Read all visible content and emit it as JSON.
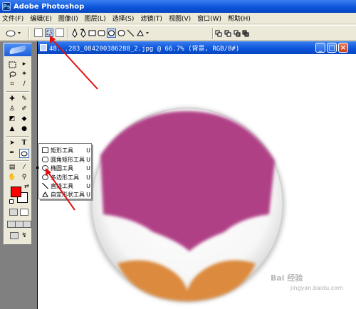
{
  "app": {
    "title": "Adobe Photoshop",
    "logo_text": "Ps"
  },
  "menubar": {
    "items": [
      "文件(F)",
      "编辑(E)",
      "图像(I)",
      "图层(L)",
      "选择(S)",
      "滤镜(T)",
      "视图(V)",
      "窗口(W)",
      "帮助(H)"
    ]
  },
  "options_bar": {
    "current_tool_icon": "ellipse-icon",
    "mode_buttons": [
      "shape-layers-icon",
      "paths-icon",
      "fill-pixels-icon"
    ],
    "shape_buttons": [
      "pen-icon",
      "freeform-pen-icon",
      "rectangle-icon",
      "rounded-rectangle-icon",
      "ellipse-icon",
      "polygon-icon",
      "line-icon",
      "custom-shape-icon"
    ],
    "combine_buttons": [
      "add-icon",
      "subtract-icon",
      "intersect-icon",
      "exclude-icon"
    ]
  },
  "document": {
    "title": "48...283_084200386288_2.jpg @ 66.7% (背景, RGB/8#)",
    "window_controls": {
      "minimize": "_",
      "maximize": "□",
      "close": "×"
    }
  },
  "flyout": {
    "items": [
      {
        "label": "矩形工具",
        "key": "U",
        "icon": "rectangle-icon"
      },
      {
        "label": "圆角矩形工具",
        "key": "U",
        "icon": "rounded-rectangle-icon"
      },
      {
        "label": "椭圆工具",
        "key": "U",
        "icon": "ellipse-icon",
        "selected": true
      },
      {
        "label": "多边形工具",
        "key": "U",
        "icon": "polygon-icon"
      },
      {
        "label": "直线工具",
        "key": "U",
        "icon": "line-icon"
      },
      {
        "label": "自定形状工具",
        "key": "U",
        "icon": "custom-shape-icon"
      }
    ]
  },
  "colors": {
    "foreground": "#ff0000",
    "background": "#ffffff",
    "logo_magenta": "#b03f86",
    "logo_orange": "#dc8a3c",
    "title_blue": "#0a53d8"
  },
  "watermark": {
    "text": "Bai 经验",
    "sub": "jingyan.baidu.com"
  }
}
